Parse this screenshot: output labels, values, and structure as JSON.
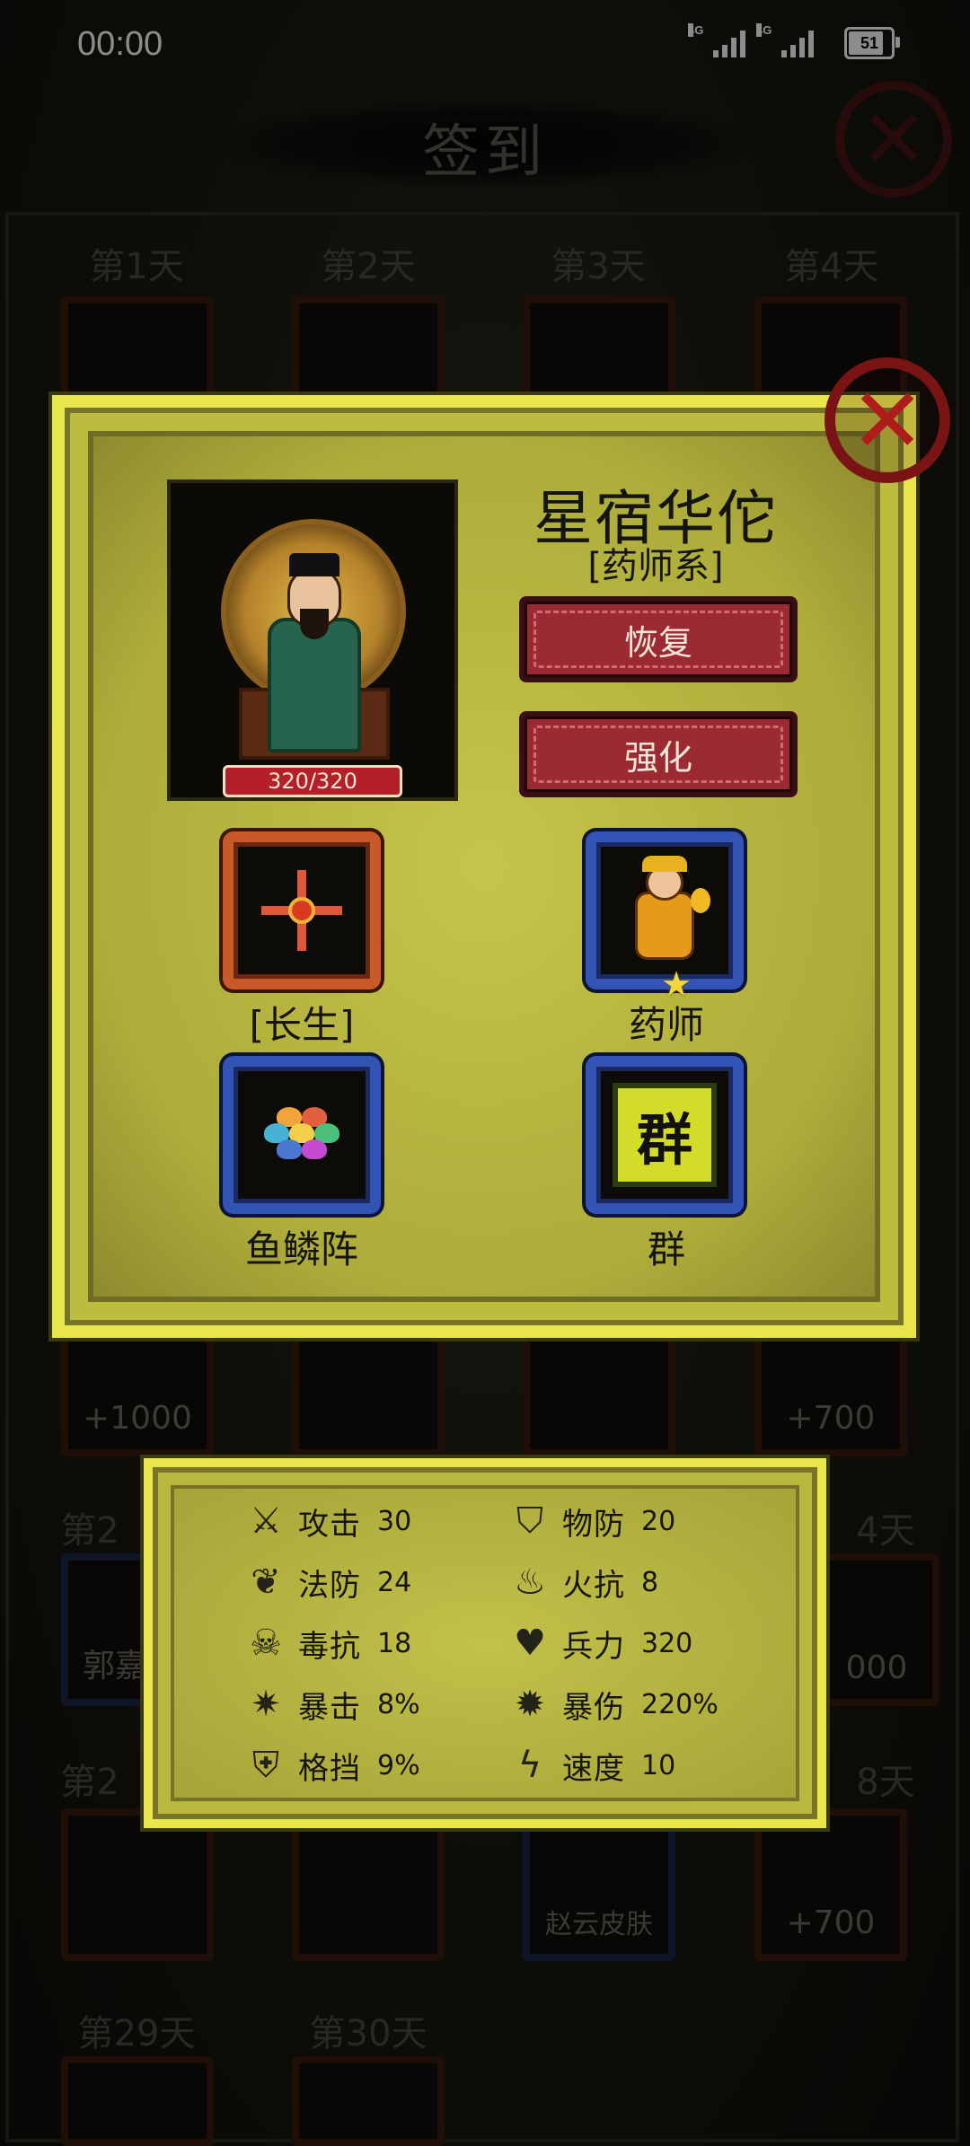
{
  "status_bar": {
    "time": "00:00",
    "signal1_label": "4G",
    "signal2_label": "4G",
    "battery": "51"
  },
  "background": {
    "title": "签到",
    "days": {
      "d1": "第1天",
      "d2": "第2天",
      "d3": "第3天",
      "d4": "第4天",
      "d29": "第29天",
      "d30": "第30天",
      "left_partial_1": "第2",
      "left_partial_2": "第2",
      "right_partial_1": "4天",
      "right_partial_2": "8天"
    },
    "rewards": {
      "r1": "+1000",
      "r2": "+700",
      "guo": "郭嘉",
      "zero": "000",
      "zhao": "赵云皮肤",
      "r3": "+700"
    }
  },
  "hero": {
    "name": "星宿华佗",
    "class": "[药师系]",
    "hp": "320/320",
    "restore_label": "恢复",
    "enhance_label": "强化",
    "skill_label": "[长生]",
    "role_label": "药师",
    "formation_label": "鱼鳞阵",
    "faction_label": "群",
    "faction_glyph": "群"
  },
  "stats": [
    {
      "name": "攻击",
      "value": "30",
      "icon": "sword-icon"
    },
    {
      "name": "物防",
      "value": "20",
      "icon": "shield-icon"
    },
    {
      "name": "法防",
      "value": "24",
      "icon": "leaf-icon"
    },
    {
      "name": "火抗",
      "value": "8",
      "icon": "flame-icon"
    },
    {
      "name": "毒抗",
      "value": "18",
      "icon": "skull-icon"
    },
    {
      "name": "兵力",
      "value": "320",
      "icon": "heart-icon"
    },
    {
      "name": "暴击",
      "value": "8%",
      "icon": "claw-icon"
    },
    {
      "name": "暴伤",
      "value": "220%",
      "icon": "bomb-icon"
    },
    {
      "name": "格挡",
      "value": "9%",
      "icon": "block-icon"
    },
    {
      "name": "速度",
      "value": "10",
      "icon": "lightning-icon"
    }
  ],
  "colors": {
    "panel_yellow": "#bebc3e",
    "button_red": "#9b2a33",
    "slot_orange": "#c85a2a",
    "slot_blue": "#3354b4"
  }
}
